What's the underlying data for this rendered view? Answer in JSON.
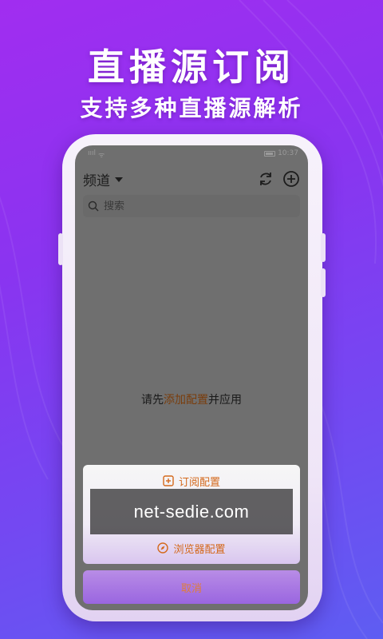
{
  "promo": {
    "title": "直播源订阅",
    "subtitle": "支持多种直播源解析"
  },
  "statusbar": {
    "signal_text": "ıııl",
    "wifi_text": "ᯤ",
    "time": "10:37"
  },
  "topbar": {
    "channel_label": "频道",
    "refresh_icon": "refresh-icon",
    "add_icon": "plus-circle-icon"
  },
  "search": {
    "placeholder": "搜索"
  },
  "empty_state": {
    "prefix": "请先",
    "link": "添加配置",
    "suffix": "并应用"
  },
  "action_sheet": {
    "items": [
      {
        "label": "订阅配置",
        "icon": "add-square-icon"
      },
      {
        "label": "浏览器配置",
        "icon": "compass-icon"
      }
    ],
    "cancel_label": "取消"
  },
  "watermark": {
    "text": "net-sedie.com"
  },
  "colors": {
    "accent_orange": "#d4691c",
    "link_brown": "#7a3d0c",
    "bg_purple": "#8a34f0"
  }
}
